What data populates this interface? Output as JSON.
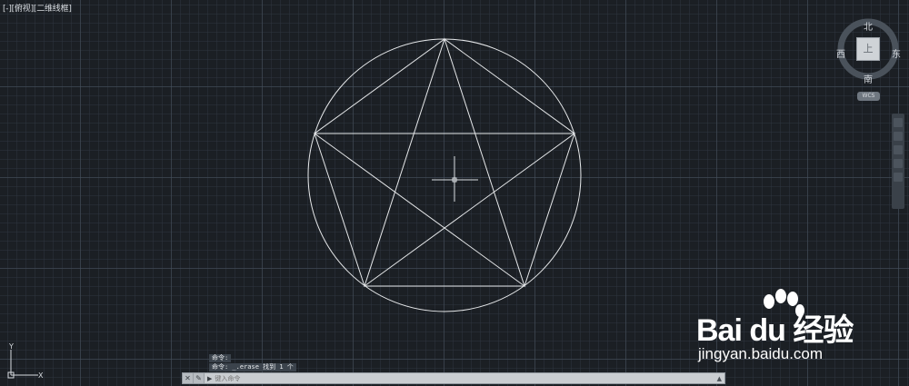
{
  "window": {
    "view_label": "[-][俯视][二维线框]"
  },
  "viewcube": {
    "north": "北",
    "south": "南",
    "east": "东",
    "west": "西",
    "face": "上",
    "wcs": "WCS"
  },
  "ucs_icon": {
    "x_label": "X",
    "y_label": "Y"
  },
  "command_line": {
    "history": [
      "命令:",
      "命令: _.erase 找到 1 个"
    ],
    "prompt_icon": "▶",
    "placeholder": "键入命令"
  },
  "watermark": {
    "brand": "Bai du 经验",
    "url": "jingyan.baidu.com"
  },
  "colors": {
    "canvas": "#1b1f24",
    "lines": "#e6e8ea",
    "cursor": "#d9dde1"
  }
}
